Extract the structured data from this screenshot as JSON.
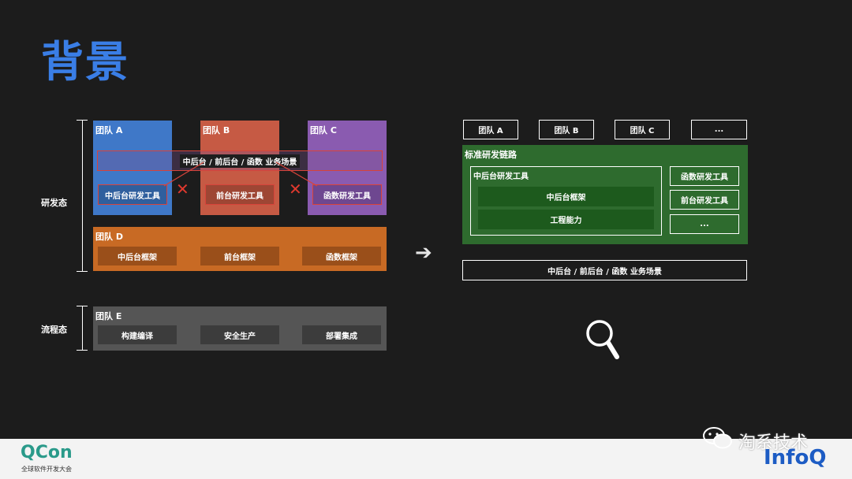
{
  "title": "背景",
  "left": {
    "side_labels": {
      "dev": "研发态",
      "flow": "流程态"
    },
    "team_a": {
      "label": "团队 A",
      "tool": "中后台研发工具",
      "color": "#3f78c8"
    },
    "team_b": {
      "label": "团队 B",
      "tool": "前台研发工具",
      "color": "#c65a44"
    },
    "team_c": {
      "label": "团队 C",
      "tool": "函数研发工具",
      "color": "#8a5bb0"
    },
    "scenario_bar": "中后台 / 前后台 / 函数 业务场景",
    "team_d": {
      "label": "团队 D",
      "items": [
        "中后台框架",
        "前台框架",
        "函数框架"
      ],
      "color": "#c86a24"
    },
    "team_e": {
      "label": "团队 E",
      "items": [
        "构建编译",
        "安全生产",
        "部署集成"
      ],
      "color": "#555555"
    },
    "cross_mark": "✕"
  },
  "arrow": "➔",
  "right": {
    "teams": [
      "团队 A",
      "团队 B",
      "团队 C",
      "..."
    ],
    "chain": {
      "title": "标准研发链路",
      "group_title": "中后台研发工具",
      "group_items": [
        "中后台框架",
        "工程能力"
      ],
      "side_items": [
        "函数研发工具",
        "前台研发工具",
        "..."
      ],
      "color": "#2e6b2e"
    },
    "scenario_bar": "中后台 / 前后台 / 函数 业务场景",
    "search_icon": "search-icon"
  },
  "footer": {
    "qcon": "QCon",
    "qcon_sub": "全球软件开发大会",
    "wechat": "淘系技术",
    "infoq": "InfoQ"
  }
}
